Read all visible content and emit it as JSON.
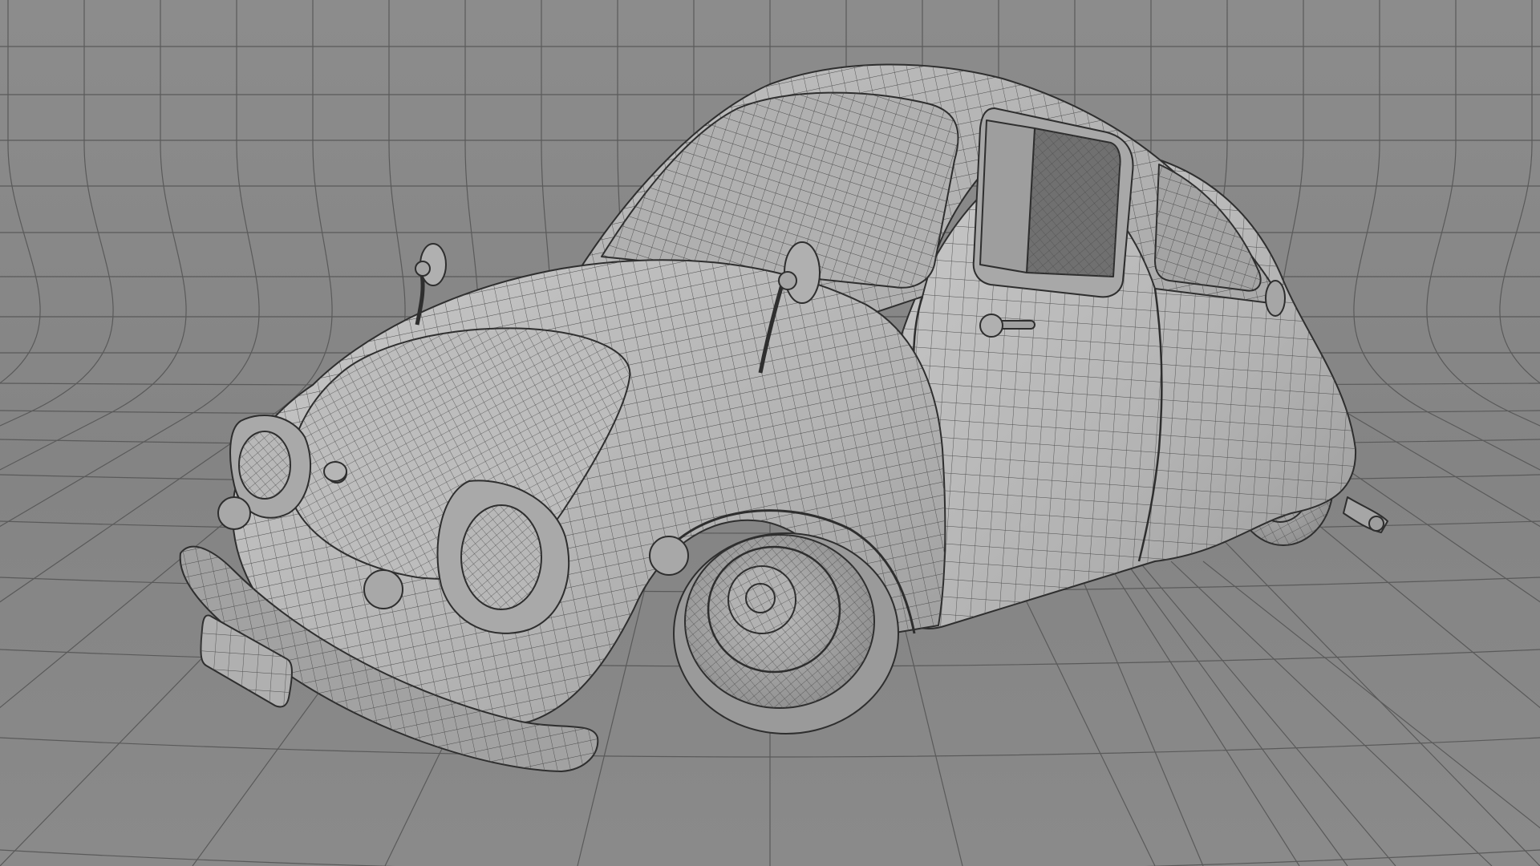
{
  "scene": {
    "subject": "wireframe-cartoon-car",
    "colors": {
      "backdrop": "#868686",
      "backdrop_top": "#8b8b8b",
      "floor": "#8a8a8a",
      "grid_line": "#5a5a5a",
      "body": "#b4b4b4",
      "body_light": "#c3c3c3",
      "body_shadow": "#8c8c8c",
      "window_dark": "#6e6e6e",
      "wire": "#4a4a4a",
      "outline": "#2e2e2e"
    }
  }
}
